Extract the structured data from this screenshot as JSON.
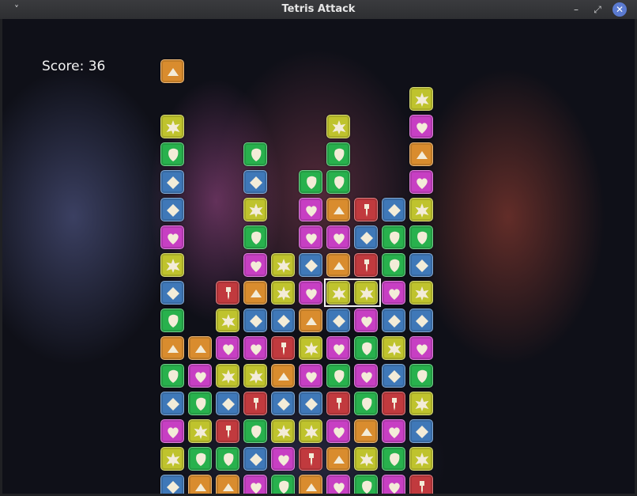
{
  "window": {
    "title": "Tetris Attack"
  },
  "controls": {
    "menu": "˅",
    "minimize": "–",
    "maximize": "⤢",
    "close": "✕"
  },
  "score_text": "Score: 36",
  "colors": {
    "triangle": "#d98c2e",
    "star": "#bfc32d",
    "shield": "#28b14d",
    "diamond": "#3f78b8",
    "heart": "#c73fc3",
    "dagger": "#c13a3e"
  },
  "board": {
    "columns": 10,
    "rows": 15,
    "cursor": {
      "row": 7,
      "col": 6,
      "width": 2
    },
    "cells": [
      [
        null,
        null,
        null,
        null,
        null,
        null,
        null,
        null,
        null,
        "star"
      ],
      [
        "star",
        null,
        null,
        null,
        null,
        null,
        "star",
        null,
        null,
        "heart"
      ],
      [
        "shield",
        null,
        null,
        "shield",
        null,
        null,
        "shield",
        null,
        null,
        "triangle"
      ],
      [
        "diamond",
        null,
        null,
        "diamond",
        null,
        "shield",
        "shield",
        null,
        null,
        "heart"
      ],
      [
        "diamond",
        null,
        null,
        "star",
        null,
        "heart",
        "triangle",
        "dagger",
        "diamond",
        "star"
      ],
      [
        "heart",
        null,
        null,
        "shield",
        null,
        "heart",
        "heart",
        "diamond",
        "shield",
        "shield"
      ],
      [
        "star",
        null,
        null,
        "heart",
        "star",
        "diamond",
        "triangle",
        "dagger",
        "shield",
        "diamond"
      ],
      [
        "diamond",
        null,
        "dagger",
        "triangle",
        "star",
        "heart",
        "star",
        "star",
        "heart",
        "star"
      ],
      [
        "shield",
        null,
        "star",
        "diamond",
        "diamond",
        "triangle",
        "diamond",
        "heart",
        "diamond",
        "diamond"
      ],
      [
        "triangle",
        "triangle",
        "heart",
        "heart",
        "dagger",
        "star",
        "heart",
        "shield",
        "star",
        "heart"
      ],
      [
        "shield",
        "heart",
        "star",
        "star",
        "triangle",
        "heart",
        "shield",
        "heart",
        "diamond",
        "shield"
      ],
      [
        "diamond",
        "shield",
        "diamond",
        "dagger",
        "diamond",
        "diamond",
        "dagger",
        "shield",
        "dagger",
        "star"
      ],
      [
        "heart",
        "star",
        "dagger",
        "shield",
        "star",
        "star",
        "heart",
        "triangle",
        "heart",
        "diamond"
      ],
      [
        "star",
        "shield",
        "shield",
        "diamond",
        "heart",
        "dagger",
        "triangle",
        "star",
        "shield",
        "star"
      ],
      [
        "diamond",
        "triangle",
        "triangle",
        "heart",
        "shield",
        "triangle",
        "heart",
        "shield",
        "heart",
        "dagger"
      ]
    ],
    "top_tile": {
      "row": -1,
      "col": 0,
      "shape": "triangle"
    }
  }
}
